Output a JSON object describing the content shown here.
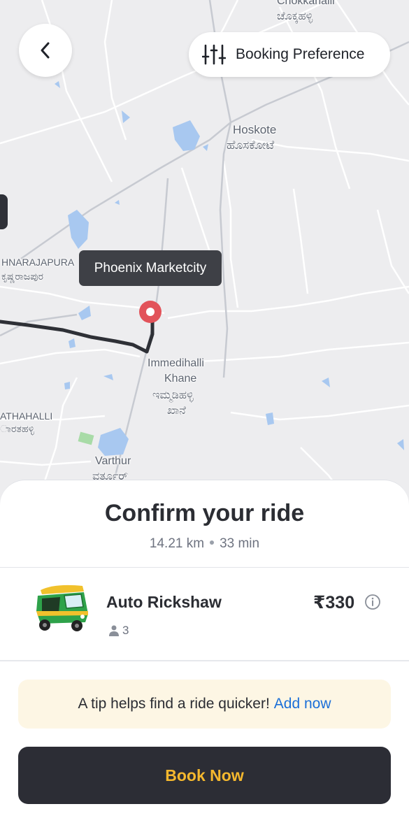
{
  "map": {
    "labels": {
      "chokkahalli_en": "Chokkahalli",
      "chokkahalli_kn": "ಚೊಕ್ಕಹಳ್ಳಿ",
      "hoskote_en": "Hoskote",
      "hoskote_kn": "ಹೊಸಕೋಟೆ",
      "krishnarajapura_en": "HNARAJAPURA",
      "krishnarajapura_kn": "ಕೃಷ್ಣರಾಜಪುರ",
      "immedihalli_en_1": "Immedihalli",
      "immedihalli_en_2": "Khane",
      "immedihalli_kn_1": "ಇಮ್ಮಡಿಹಳ್ಳಿ",
      "immedihalli_kn_2": "ಖಾನೆ",
      "marathahalli_en": "ATHAHALLI",
      "marathahalli_kn": "ಾರತಹಳ್ಳಿ",
      "varthur_en": "Varthur",
      "varthur_kn": "ವರ್ತೂರ್"
    },
    "destination_tooltip": "Phoenix Marketcity",
    "route_color": "#2e3036",
    "pin_color": "#e2535a"
  },
  "header": {
    "back_icon": "chevron-left-icon",
    "preference_icon": "sliders-icon",
    "preference_label": "Booking Preference"
  },
  "sheet": {
    "title": "Confirm your ride",
    "distance": "14.21 km",
    "duration": "33 min"
  },
  "ride": {
    "name": "Auto Rickshaw",
    "seats": "3",
    "price": "₹330",
    "icon": "auto-rickshaw-icon"
  },
  "tip": {
    "text": "A tip helps find a ride quicker!",
    "link": "Add now"
  },
  "book": {
    "label": "Book Now",
    "text_color": "#f5b82e",
    "bg_color": "#2c2d35"
  }
}
